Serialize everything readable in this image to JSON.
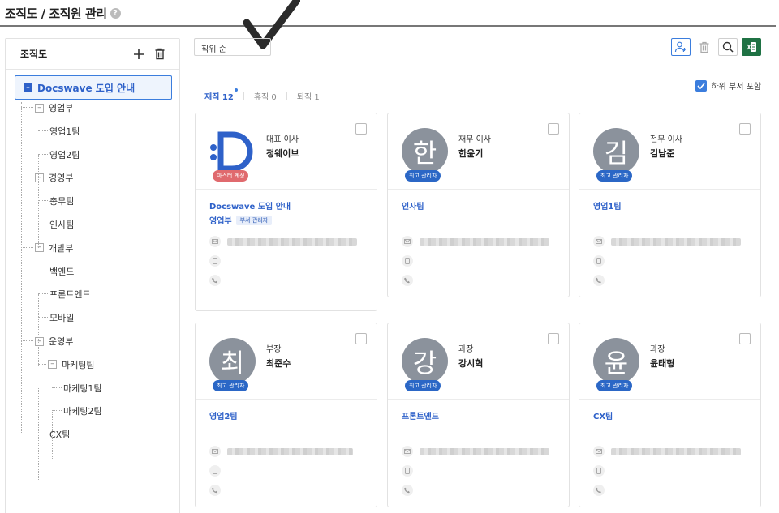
{
  "header": {
    "title": "조직도 / 조직원 관리",
    "help": "?"
  },
  "sidebar": {
    "title": "조직도",
    "root": "Docswave 도입 안내",
    "tree": [
      {
        "label": "영업부",
        "level": 1,
        "collapsible": true
      },
      {
        "label": "영업1팀",
        "level": 2,
        "collapsible": false
      },
      {
        "label": "영업2팀",
        "level": 2,
        "collapsible": false
      },
      {
        "label": "경영부",
        "level": 1,
        "collapsible": true
      },
      {
        "label": "총무팀",
        "level": 2,
        "collapsible": false
      },
      {
        "label": "인사팀",
        "level": 2,
        "collapsible": false
      },
      {
        "label": "개발부",
        "level": 1,
        "collapsible": true
      },
      {
        "label": "백엔드",
        "level": 2,
        "collapsible": false
      },
      {
        "label": "프론트엔드",
        "level": 2,
        "collapsible": false
      },
      {
        "label": "모바일",
        "level": 2,
        "collapsible": false
      },
      {
        "label": "운영부",
        "level": 1,
        "collapsible": true
      },
      {
        "label": "마케팅팀",
        "level": 2,
        "collapsible": true
      },
      {
        "label": "마케팅1팀",
        "level": 3,
        "collapsible": false
      },
      {
        "label": "마케팅2팀",
        "level": 3,
        "collapsible": false
      },
      {
        "label": "CX팀",
        "level": 2,
        "collapsible": false
      }
    ]
  },
  "main": {
    "sort": "직위 순",
    "include_sub": "하위 부서 포함",
    "tabs": [
      {
        "label": "재직 12",
        "active": true
      },
      {
        "label": "휴직 0",
        "active": false
      },
      {
        "label": "퇴직 1",
        "active": false
      }
    ],
    "cards": [
      {
        "initial": "",
        "logo": true,
        "title": "대표 이사",
        "name": "정웨이브",
        "badge": "마스터 계정",
        "badge_type": "master",
        "dept": "Docswave 도입 안내",
        "dept2": "영업부",
        "dept2_badge": "부서 관리자"
      },
      {
        "initial": "한",
        "title": "재무 이사",
        "name": "한윤기",
        "badge": "최고 관리자",
        "dept": "인사팀"
      },
      {
        "initial": "김",
        "title": "전무 이사",
        "name": "김남준",
        "badge": "최고 관리자",
        "dept": "영업1팀"
      },
      {
        "initial": "최",
        "title": "부장",
        "name": "최준수",
        "badge": "최고 관리자",
        "dept": "영업2팀"
      },
      {
        "initial": "강",
        "title": "과장",
        "name": "강시혁",
        "badge": "최고 관리자",
        "dept": "프론트엔드"
      },
      {
        "initial": "윤",
        "title": "과장",
        "name": "윤태형",
        "badge": "최고 관리자",
        "dept": "CX팀"
      }
    ]
  },
  "colors": {
    "accent": "#2e61c9",
    "badge": "#2b67c6",
    "master_badge": "#e06a6e",
    "excel": "#1f7244",
    "avatar_bg": "#8b929c"
  }
}
